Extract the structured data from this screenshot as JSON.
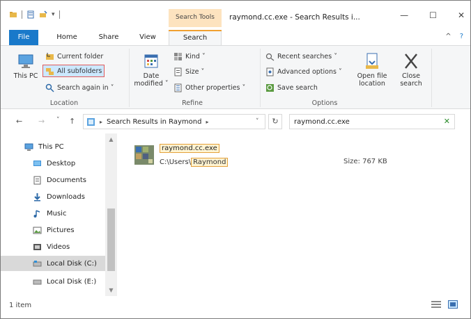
{
  "window": {
    "title": "raymond.cc.exe - Search Results i...",
    "contextual_tab_header": "Search Tools",
    "minimize": "—",
    "maximize": "☐",
    "close": "✕"
  },
  "tabs": {
    "file": "File",
    "home": "Home",
    "share": "Share",
    "view": "View",
    "search": "Search",
    "collapse_ribbon": "^",
    "help": "?"
  },
  "ribbon": {
    "location": {
      "label": "Location",
      "this_pc": "This PC",
      "current_folder": "Current folder",
      "all_subfolders": "All subfolders",
      "search_again_in": "Search again in ˅"
    },
    "refine": {
      "label": "Refine",
      "date_modified": "Date modified ˅",
      "kind": "Kind ˅",
      "size": "Size ˅",
      "other_properties": "Other properties ˅"
    },
    "options": {
      "label": "Options",
      "recent_searches": "Recent searches ˅",
      "advanced_options": "Advanced options ˅",
      "save_search": "Save search",
      "open_file_location": "Open file location",
      "close_search": "Close search"
    }
  },
  "address": {
    "back": "←",
    "forward": "→",
    "recent": "˅",
    "up": "↑",
    "path": "Search Results in Raymond",
    "dropdown": "˅",
    "refresh": "↻",
    "search_value": "raymond.cc.exe",
    "search_clear": "✕"
  },
  "nav": {
    "items": [
      {
        "label": "This PC"
      },
      {
        "label": "Desktop"
      },
      {
        "label": "Documents"
      },
      {
        "label": "Downloads"
      },
      {
        "label": "Music"
      },
      {
        "label": "Pictures"
      },
      {
        "label": "Videos"
      },
      {
        "label": "Local Disk (C:)"
      },
      {
        "label": "Local Disk (E:)"
      }
    ],
    "scroll_up": "▲",
    "scroll_down": "▼"
  },
  "result": {
    "filename": "raymond.cc.exe",
    "path_prefix": "C:\\Users\\",
    "path_highlight": "Raymond",
    "size": "Size: 767 KB"
  },
  "status": {
    "count": "1 item"
  },
  "colors": {
    "file_tab": "#1979ca",
    "contextual_tab": "#fde3bf",
    "highlight_border": "#e3a03a",
    "selection": "#cce8ff"
  }
}
